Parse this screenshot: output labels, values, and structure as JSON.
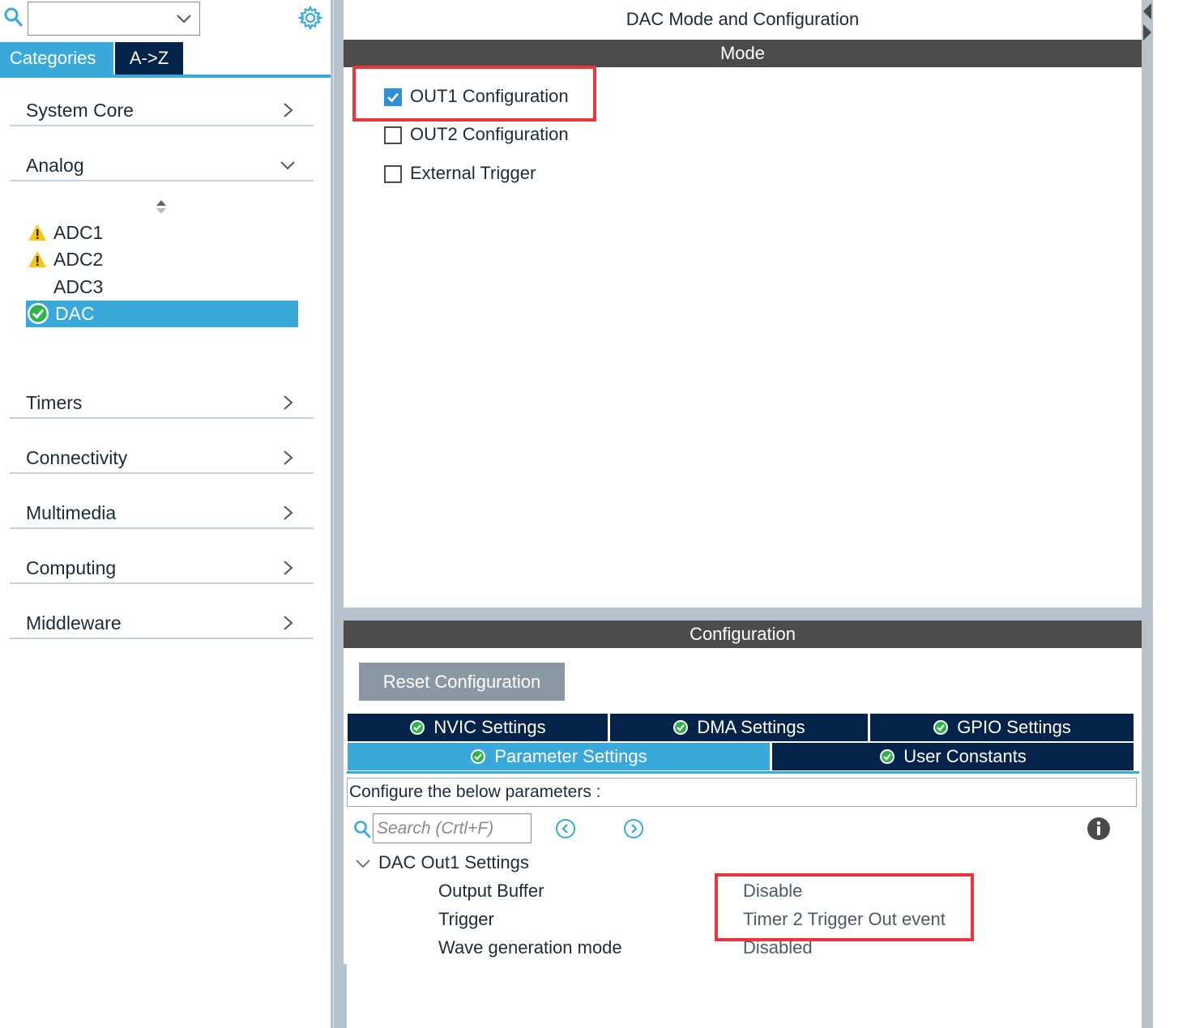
{
  "sidebar": {
    "search_value": "",
    "tabs": {
      "categories": "Categories",
      "az": "A->Z"
    },
    "categories": [
      {
        "label": "System Core",
        "expanded": false
      },
      {
        "label": "Analog",
        "expanded": true
      },
      {
        "label": "Timers",
        "expanded": false
      },
      {
        "label": "Connectivity",
        "expanded": false
      },
      {
        "label": "Multimedia",
        "expanded": false
      },
      {
        "label": "Computing",
        "expanded": false
      },
      {
        "label": "Middleware",
        "expanded": false
      }
    ],
    "analog_items": [
      {
        "label": "ADC1",
        "status": "warning"
      },
      {
        "label": "ADC2",
        "status": "warning"
      },
      {
        "label": "ADC3",
        "status": "none"
      },
      {
        "label": "DAC",
        "status": "ok",
        "selected": true
      }
    ]
  },
  "main": {
    "title": "DAC Mode and Configuration",
    "mode_header": "Mode",
    "mode_options": [
      {
        "label": "OUT1 Configuration",
        "checked": true
      },
      {
        "label": "OUT2 Configuration",
        "checked": false
      },
      {
        "label": "External Trigger",
        "checked": false
      }
    ],
    "config_header": "Configuration",
    "reset_button": "Reset Configuration",
    "tabs": [
      {
        "label": "NVIC Settings",
        "active": false
      },
      {
        "label": "DMA Settings",
        "active": false
      },
      {
        "label": "GPIO Settings",
        "active": false
      },
      {
        "label": "Parameter Settings",
        "active": true
      },
      {
        "label": "User Constants",
        "active": false
      }
    ],
    "description": "Configure the below parameters :",
    "param_search_placeholder": "Search (Crtl+F)",
    "group": {
      "label": "DAC Out1 Settings",
      "params": [
        {
          "name": "Output Buffer",
          "value": "Disable"
        },
        {
          "name": "Trigger",
          "value": "Timer 2 Trigger Out event"
        },
        {
          "name": "Wave generation mode",
          "value": "Disabled"
        }
      ]
    }
  },
  "colors": {
    "accent": "#39a9dc",
    "navy": "#03234b",
    "section_bar": "#4b4b4b",
    "highlight_red": "#e8363c",
    "warning": "#f5c518",
    "ok_green": "#2fb34a"
  }
}
